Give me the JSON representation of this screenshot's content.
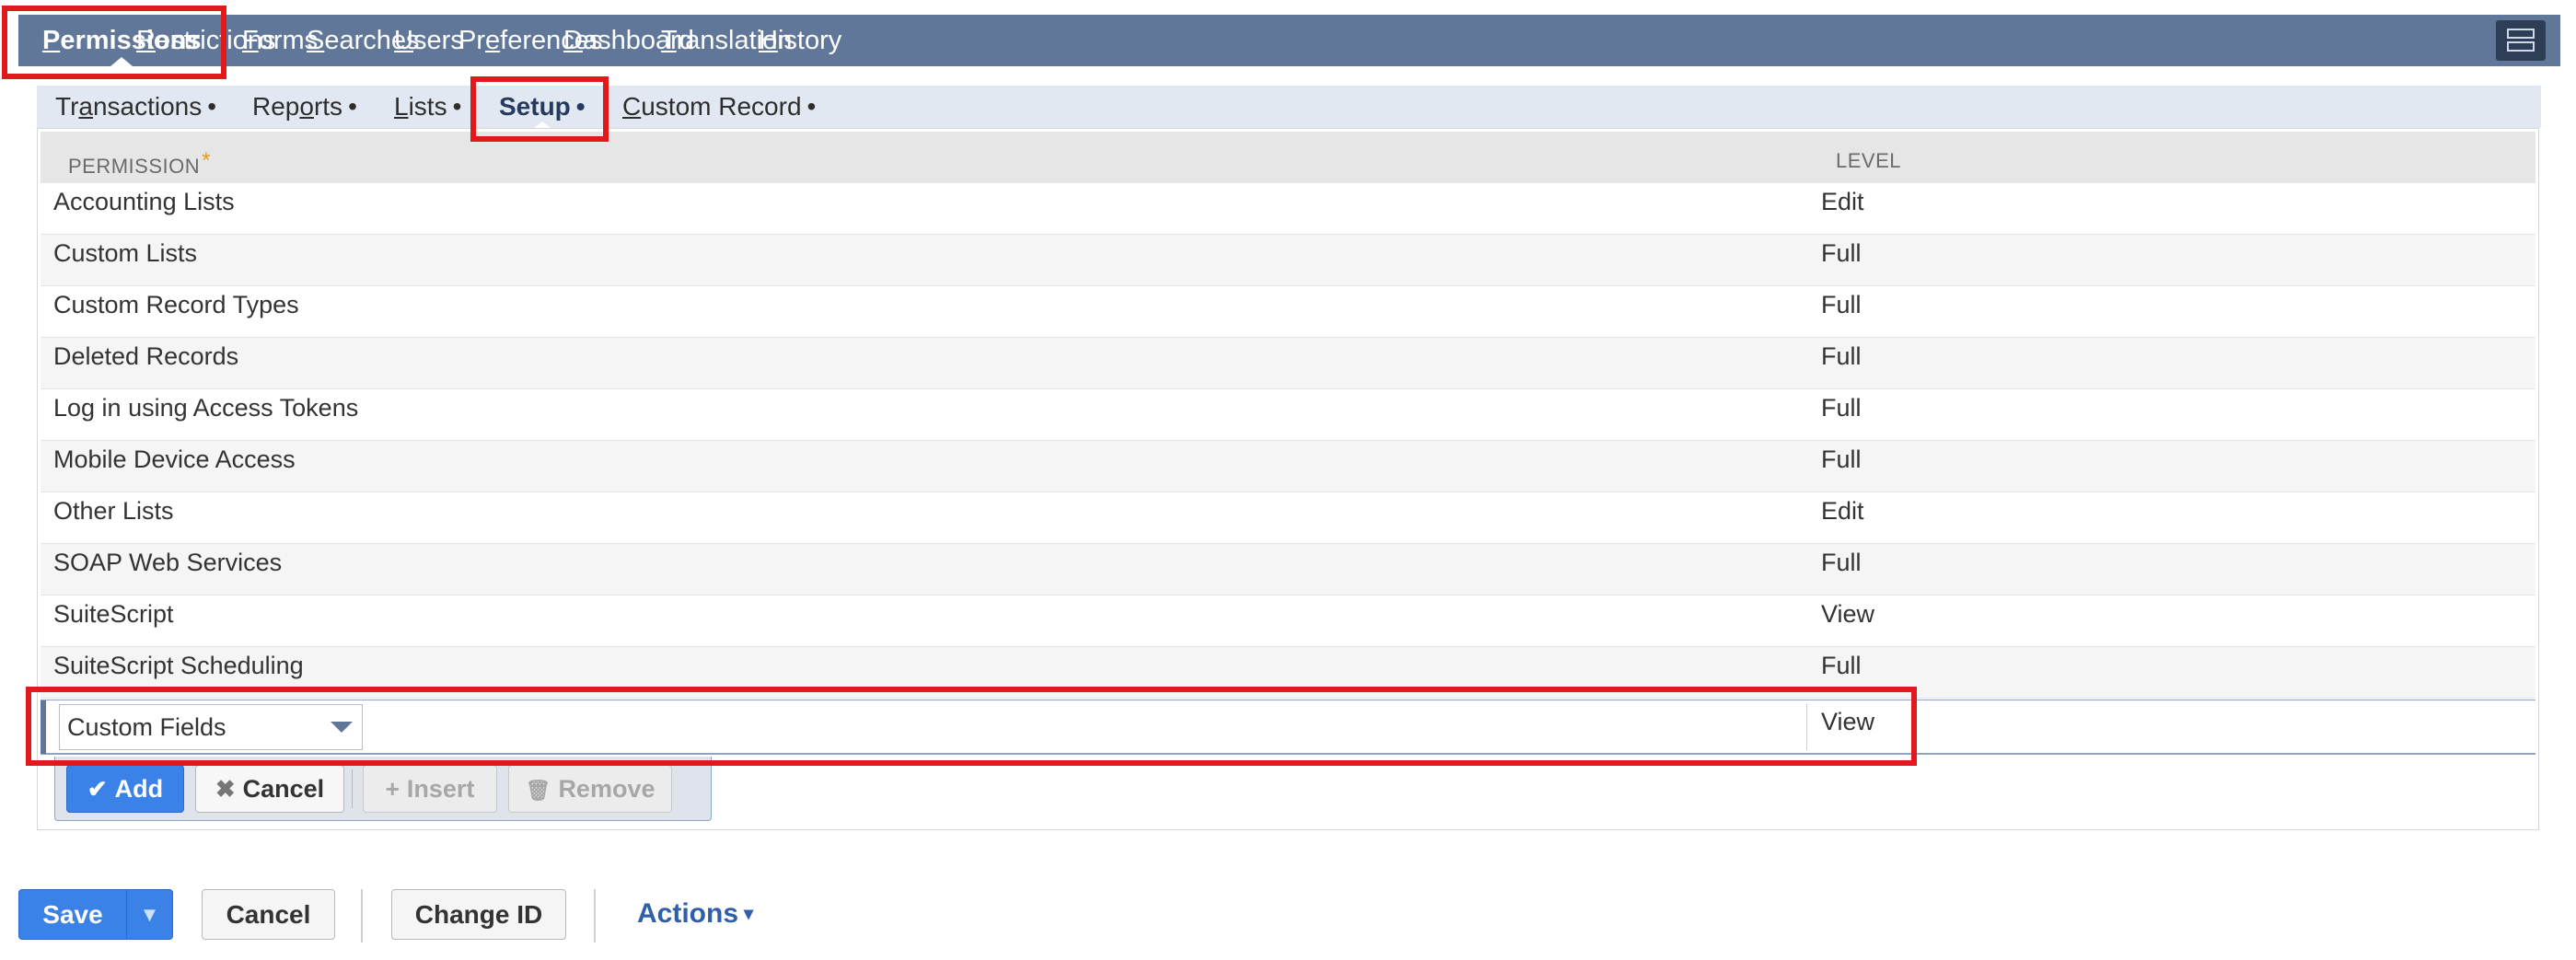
{
  "top_tabs": [
    {
      "pre": "",
      "mn": "P",
      "post": "ermissions"
    },
    {
      "pre": "",
      "mn": "R",
      "post": "estrictions"
    },
    {
      "pre": "",
      "mn": "F",
      "post": "orms"
    },
    {
      "pre": "",
      "mn": "S",
      "post": "earches"
    },
    {
      "pre": "",
      "mn": "U",
      "post": "sers"
    },
    {
      "pre": "Pr",
      "mn": "e",
      "post": "ferences"
    },
    {
      "pre": "",
      "mn": "D",
      "post": "ashboard"
    },
    {
      "pre": "",
      "mn": "T",
      "post": "ranslation"
    },
    {
      "pre": "",
      "mn": "H",
      "post": "istory"
    }
  ],
  "layout_icon": "layout-toggle-icon",
  "sub_tabs": [
    {
      "pre": "Tr",
      "mn": "a",
      "post": "nsactions",
      "dot": "•"
    },
    {
      "pre": "Rep",
      "mn": "o",
      "post": "rts",
      "dot": "•"
    },
    {
      "pre": "",
      "mn": "L",
      "post": "ists",
      "dot": "•"
    },
    {
      "pre": "Setup",
      "mn": "",
      "post": "",
      "dot": "•"
    },
    {
      "pre": "",
      "mn": "C",
      "post": "ustom Record",
      "dot": "•"
    }
  ],
  "table": {
    "headers": {
      "permission": "PERMISSION",
      "required_mark": "*",
      "level": "LEVEL"
    },
    "rows": [
      {
        "permission": "Accounting Lists",
        "level": "Edit"
      },
      {
        "permission": "Custom Lists",
        "level": "Full"
      },
      {
        "permission": "Custom Record Types",
        "level": "Full"
      },
      {
        "permission": "Deleted Records",
        "level": "Full"
      },
      {
        "permission": "Log in using Access Tokens",
        "level": "Full"
      },
      {
        "permission": "Mobile Device Access",
        "level": "Full"
      },
      {
        "permission": "Other Lists",
        "level": "Edit"
      },
      {
        "permission": "SOAP Web Services",
        "level": "Full"
      },
      {
        "permission": "SuiteScript",
        "level": "View"
      },
      {
        "permission": "SuiteScript Scheduling",
        "level": "Full"
      }
    ],
    "edit_row": {
      "permission": "Custom Fields",
      "level": "View"
    }
  },
  "row_buttons": {
    "add": {
      "icon": "✔",
      "label": "Add"
    },
    "cancel": {
      "icon": "✖",
      "label": "Cancel"
    },
    "insert": {
      "icon": "+",
      "label": "Insert"
    },
    "remove": {
      "icon": "🗑",
      "label": "Remove"
    }
  },
  "footer": {
    "save": "Save",
    "save_menu": "▼",
    "cancel": "Cancel",
    "change_id": "Change ID",
    "actions": "Actions",
    "actions_caret": "▾"
  },
  "colors": {
    "tab_bar": "#607799",
    "primary_button": "#3a82e8",
    "highlight": "#e0191c"
  }
}
